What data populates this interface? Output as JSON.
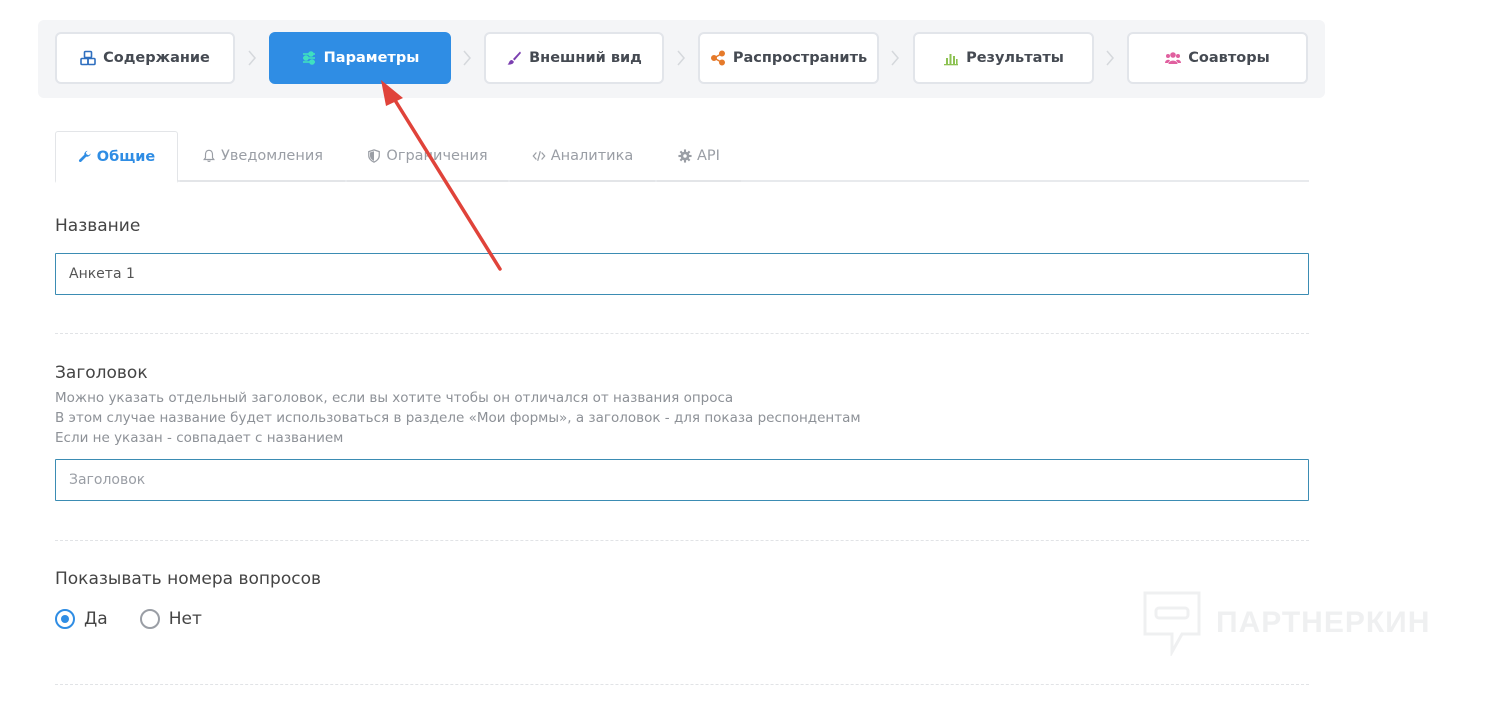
{
  "wizard": {
    "steps": [
      {
        "label": "Содержание",
        "icon": "cubes-icon",
        "active": false
      },
      {
        "label": "Параметры",
        "icon": "sliders-icon",
        "active": true
      },
      {
        "label": "Внешний вид",
        "icon": "brush-icon",
        "active": false
      },
      {
        "label": "Распространить",
        "icon": "share-icon",
        "active": false
      },
      {
        "label": "Результаты",
        "icon": "bar-chart-icon",
        "active": false
      },
      {
        "label": "Соавторы",
        "icon": "users-icon",
        "active": false
      }
    ]
  },
  "tabs": [
    {
      "label": "Общие",
      "icon": "wrench-icon",
      "active": true
    },
    {
      "label": "Уведомления",
      "icon": "bell-icon",
      "active": false
    },
    {
      "label": "Ограничения",
      "icon": "shield-icon",
      "active": false
    },
    {
      "label": "Аналитика",
      "icon": "code-icon",
      "active": false
    },
    {
      "label": "API",
      "icon": "gear-icon",
      "active": false
    }
  ],
  "form": {
    "name": {
      "label": "Название",
      "value": "Анкета 1"
    },
    "heading": {
      "label": "Заголовок",
      "help": [
        "Можно указать отдельный заголовок, если вы хотите чтобы он отличался от названия опроса",
        "В этом случае название будет использоваться в разделе «Мои формы», а заголовок - для показа респондентам",
        "Если не указан - совпадает с названием"
      ],
      "value": "",
      "placeholder": "Заголовок"
    },
    "show_numbers": {
      "label": "Показывать номера вопросов",
      "options": [
        {
          "label": "Да",
          "checked": true
        },
        {
          "label": "Нет",
          "checked": false
        }
      ]
    }
  },
  "watermark": {
    "text": "ПАРТНЕРКИН"
  },
  "colors": {
    "accent": "#2f8de4",
    "annotation_arrow": "#e0433a",
    "step_icons": {
      "cubes-icon": "#2f6fbf",
      "sliders-icon": "#3fe0c0",
      "brush-icon": "#7b3fb0",
      "share-icon": "#e57a2b",
      "bar-chart-icon": "#8cc152",
      "users-icon": "#e0609f"
    }
  }
}
